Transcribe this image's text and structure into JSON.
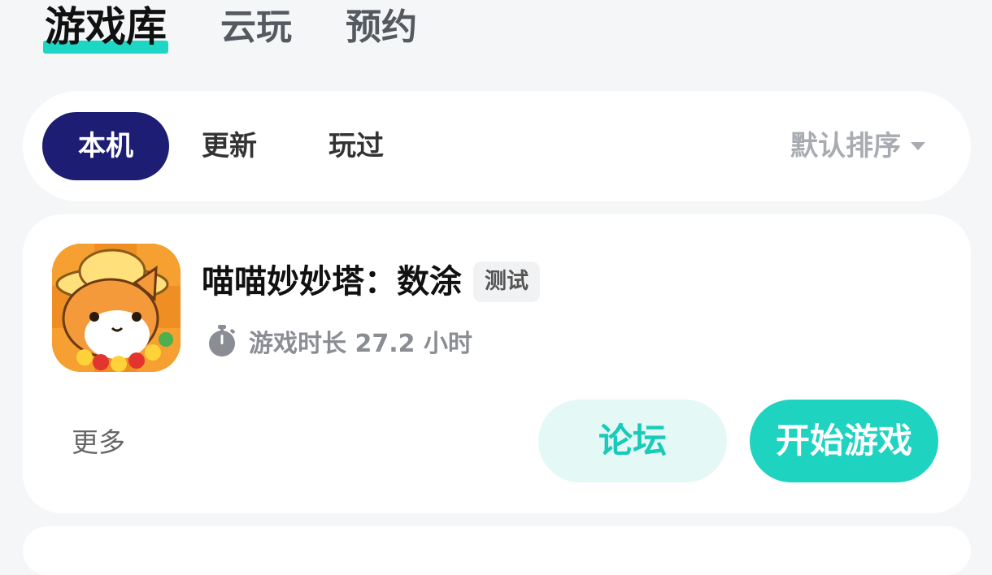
{
  "top_tabs": [
    {
      "label": "游戏库",
      "active": true
    },
    {
      "label": "云玩",
      "active": false
    },
    {
      "label": "预约",
      "active": false
    }
  ],
  "filters": {
    "chips": [
      {
        "label": "本机",
        "active": true
      },
      {
        "label": "更新",
        "active": false
      },
      {
        "label": "玩过",
        "active": false
      }
    ],
    "sort_label": "默认排序"
  },
  "game": {
    "title": "喵喵妙妙塔：数涂",
    "tag": "测试",
    "playtime": "游戏时长 27.2 小时",
    "more_label": "更多",
    "forum_label": "论坛",
    "start_label": "开始游戏",
    "icon": "cat-game-icon"
  },
  "colors": {
    "accent": "#1fd3c1",
    "active_chip": "#1c1d73",
    "forum_bg": "#e4f8f6"
  }
}
